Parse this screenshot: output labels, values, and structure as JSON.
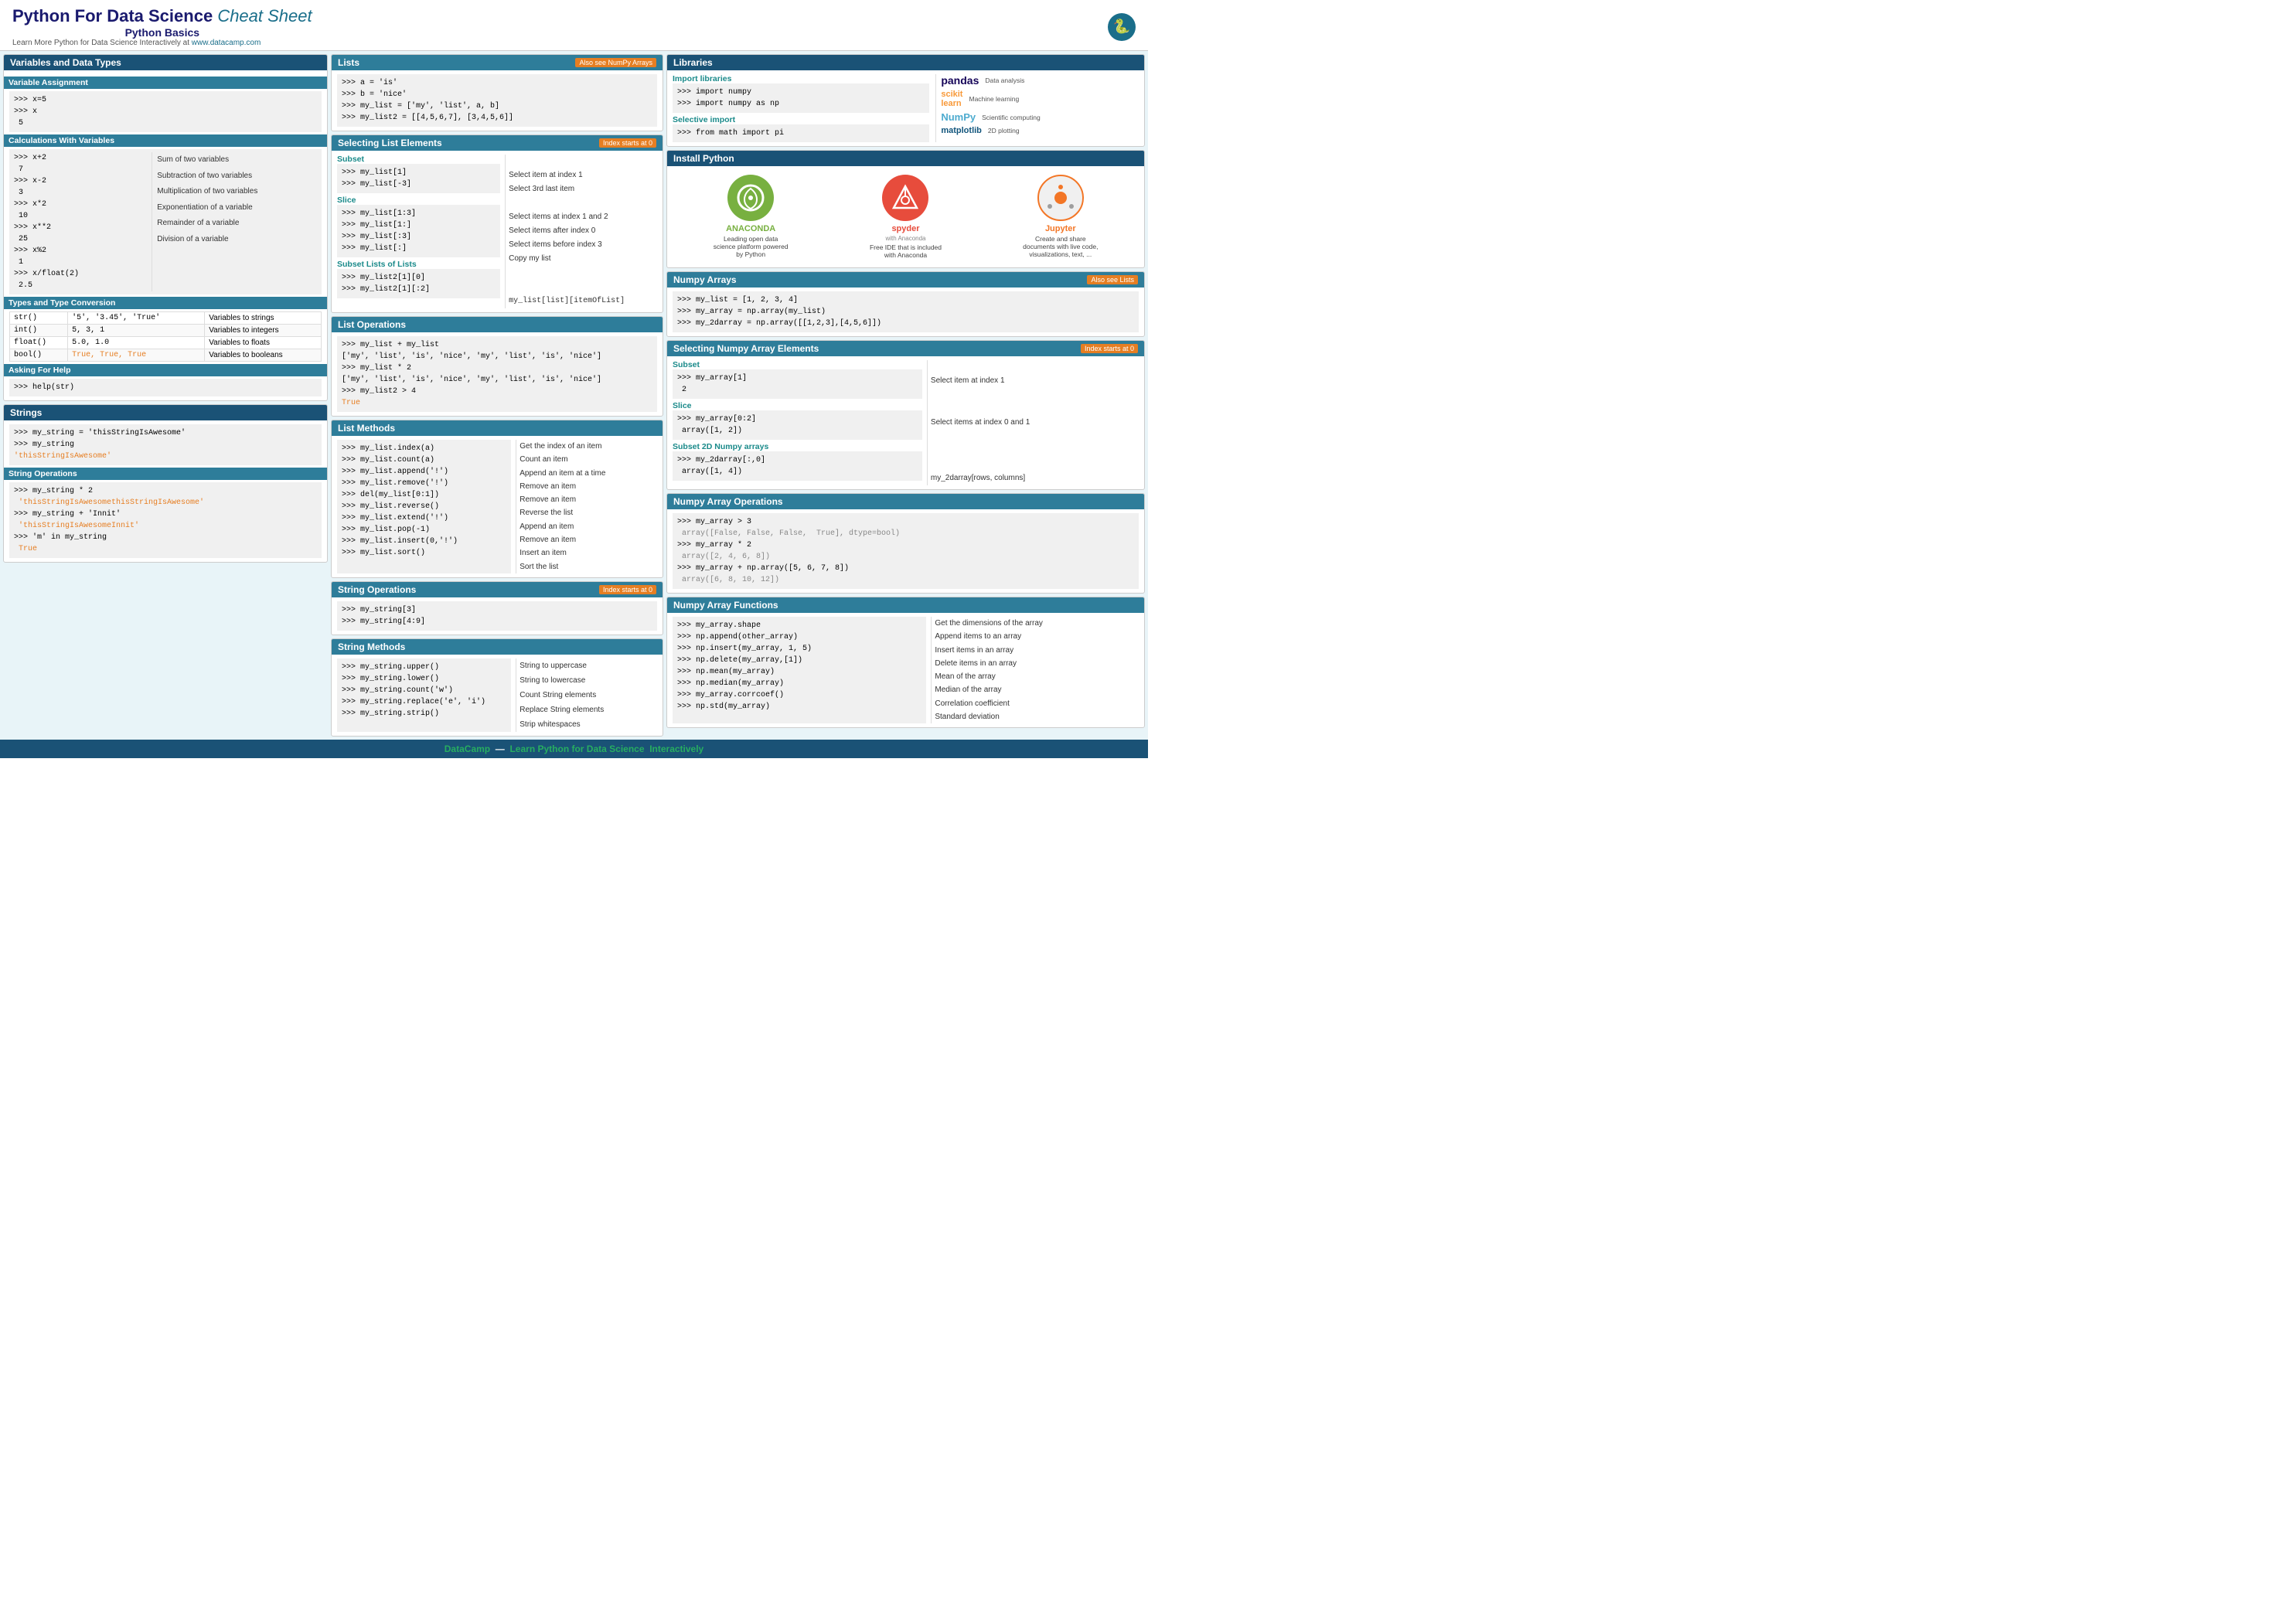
{
  "header": {
    "title_part1": "Python For Data Science",
    "title_italic": "Cheat Sheet",
    "subtitle": "Python Basics",
    "learn_text": "Learn More Python for Data Science Interactively at",
    "url": "www.datacamp.com"
  },
  "variables": {
    "section_title": "Variables and Data Types",
    "assignment_title": "Variable Assignment",
    "assignment_code": ">>> x=5\n>>> x\n 5",
    "calc_title": "Calculations With Variables",
    "calc_rows": [
      {
        "code": ">>> x+2\n 7",
        "desc": "Sum of two variables"
      },
      {
        "code": ">>> x-2\n 3",
        "desc": "Subtraction of two variables"
      },
      {
        "code": ">>> x*2\n 10",
        "desc": "Multiplication of two variables"
      },
      {
        "code": ">>> x**2\n 25",
        "desc": "Exponentiation of a variable"
      },
      {
        "code": ">>> x%2\n 1",
        "desc": "Remainder of a variable"
      },
      {
        "code": ">>> x/float(2)\n 2.5",
        "desc": "Division of a variable"
      }
    ],
    "types_title": "Types and Type Conversion",
    "types_rows": [
      {
        "func": "str()",
        "example": "'5', '3.45', 'True'",
        "desc": "Variables to strings"
      },
      {
        "func": "int()",
        "example": "5, 3, 1",
        "desc": "Variables to integers"
      },
      {
        "func": "float()",
        "example": "5.0, 1.0",
        "desc": "Variables to floats"
      },
      {
        "func": "bool()",
        "example": "True, True, True",
        "desc": "Variables to booleans"
      }
    ],
    "help_title": "Asking For Help",
    "help_code": ">>> help(str)"
  },
  "strings": {
    "section_title": "Strings",
    "code": ">>> my_string = 'thisStringIsAwesome'\n>>> my_string\n'thisStringIsAwesome'",
    "ops_title": "String Operations",
    "ops_code": ">>> my_string * 2\n 'thisStringIsAwesomethisStringIsAwesome'\n>>> my_string + 'Innit'\n 'thisStringIsAwesomeInnit'\n>>> 'm' in my_string\n True"
  },
  "lists": {
    "section_title": "Lists",
    "also_see": "Also see NumPy Arrays",
    "code": ">>> a = 'is'\n>>> b = 'nice'\n>>> my_list = ['my', 'list', a, b]\n>>> my_list2 = [[4,5,6,7], [3,4,5,6]]",
    "selecting_title": "Selecting List Elements",
    "index_badge": "Index starts at 0",
    "subset_title": "Subset",
    "subset_items": [
      {
        "code": ">>> my_list[1]",
        "desc": "Select item at index 1"
      },
      {
        "code": ">>> my_list[-3]",
        "desc": "Select 3rd last item"
      }
    ],
    "slice_title": "Slice",
    "slice_items": [
      {
        "code": ">>> my_list[1:3]",
        "desc": "Select items at index 1 and 2"
      },
      {
        "code": ">>> my_list[1:]",
        "desc": "Select items after index 0"
      },
      {
        "code": ">>> my_list[:3]",
        "desc": "Select items before index 3"
      },
      {
        "code": ">>> my_list[:]",
        "desc": "Copy my list"
      }
    ],
    "subset_lists_title": "Subset Lists of Lists",
    "subset_lists_items": [
      {
        "code": ">>> my_list2[1][0]",
        "desc": ""
      },
      {
        "code": ">>> my_list2[1][:2]",
        "desc": "my_list[list][itemOfList]"
      }
    ],
    "ops_title": "List Operations",
    "ops_code": ">>> my_list + my_list\n['my', 'list', 'is', 'nice', 'my', 'list', 'is', 'nice']\n>>> my_list * 2\n['my', 'list', 'is', 'nice', 'my', 'list', 'is', 'nice']\n>>> my_list2 > 4\nTrue",
    "methods_title": "List Methods",
    "methods": [
      {
        "code": ">>> my_list.index(a)",
        "desc": "Get the index of an item"
      },
      {
        "code": ">>> my_list.count(a)",
        "desc": "Count an item"
      },
      {
        "code": ">>> my_list.append('!')",
        "desc": "Append an item at a time"
      },
      {
        "code": ">>> my_list.remove('!')",
        "desc": "Remove an item"
      },
      {
        "code": ">>> del(my_list[0:1])",
        "desc": "Remove an item"
      },
      {
        "code": ">>> my_list.reverse()",
        "desc": "Reverse the list"
      },
      {
        "code": ">>> my_list.extend('!')",
        "desc": "Append an item"
      },
      {
        "code": ">>> my_list.pop(-1)",
        "desc": "Remove an item"
      },
      {
        "code": ">>> my_list.insert(0,'!')",
        "desc": "Insert an item"
      },
      {
        "code": ">>> my_list.sort()",
        "desc": "Sort the list"
      }
    ]
  },
  "string_ops_mid": {
    "section_title": "String Operations",
    "index_badge": "Index starts at 0",
    "code": ">>> my_string[3]\n>>> my_string[4:9]",
    "methods_title": "String Methods",
    "methods": [
      {
        "code": ">>> my_string.upper()",
        "desc": "String to uppercase"
      },
      {
        "code": ">>> my_string.lower()",
        "desc": "String to lowercase"
      },
      {
        "code": ">>> my_string.count('w')",
        "desc": "Count String elements"
      },
      {
        "code": ">>> my_string.replace('e', 'i')",
        "desc": "Replace String elements"
      },
      {
        "code": ">>> my_string.strip()",
        "desc": "Strip whitespaces"
      }
    ]
  },
  "libraries": {
    "section_title": "Libraries",
    "import_title": "Import libraries",
    "import_code": ">>> import numpy\n>>> import numpy as np",
    "selective_title": "Selective import",
    "selective_code": ">>> from math import pi",
    "logos": [
      {
        "name": "pandas",
        "desc": "Data analysis"
      },
      {
        "name": "scikit-learn",
        "desc": "Machine learning"
      },
      {
        "name": "NumPy",
        "desc": "Scientific computing"
      },
      {
        "name": "matplotlib",
        "desc": "2D plotting"
      }
    ]
  },
  "install": {
    "section_title": "Install Python",
    "items": [
      {
        "name": "ANACONDA",
        "desc": "Leading open data science platform powered by Python"
      },
      {
        "name": "spyder",
        "subtitle": "with Anaconda",
        "desc": "Free IDE that is included with Anaconda"
      },
      {
        "name": "Jupyter",
        "desc": "Create and share documents with live code, visualizations, text, ..."
      }
    ]
  },
  "numpy": {
    "section_title": "Numpy Arrays",
    "also_see": "Also see Lists",
    "code": ">>> my_list = [1, 2, 3, 4]\n>>> my_array = np.array(my_list)\n>>> my_2darray = np.array([[1,2,3],[4,5,6]])",
    "selecting_title": "Selecting Numpy Array Elements",
    "index_badge": "Index starts at 0",
    "subset_title": "Subset",
    "subset_items": [
      {
        "code": ">>> my_array[1]\n 2",
        "desc": "Select item at index 1"
      }
    ],
    "slice_title": "Slice",
    "slice_items": [
      {
        "code": ">>> my_array[0:2]\n array([1, 2])",
        "desc": "Select items at index 0 and 1"
      }
    ],
    "subset2d_title": "Subset 2D Numpy arrays",
    "subset2d_items": [
      {
        "code": ">>> my_2darray[:,0]\n array([1, 4])",
        "desc": "my_2darray[rows, columns]"
      }
    ],
    "ops_title": "Numpy Array Operations",
    "ops_code": ">>> my_array > 3\n array([False, False, False,  True], dtype=bool)\n>>> my_array * 2\n array([2, 4, 6, 8])\n>>> my_array + np.array([5, 6, 7, 8])\n array([6, 8, 10, 12])",
    "functions_title": "Numpy Array Functions",
    "functions": [
      {
        "code": ">>> my_array.shape",
        "desc": "Get the dimensions of the array"
      },
      {
        "code": ">>> np.append(other_array)",
        "desc": "Append items to an array"
      },
      {
        "code": ">>> np.insert(my_array, 1, 5)",
        "desc": "Insert items in an array"
      },
      {
        "code": ">>> np.delete(my_array,[1])",
        "desc": "Delete items in an array"
      },
      {
        "code": ">>> np.mean(my_array)",
        "desc": "Mean of the array"
      },
      {
        "code": ">>> np.median(my_array)",
        "desc": "Median of the array"
      },
      {
        "code": ">>> my_array.corrcoef()",
        "desc": "Correlation coefficient"
      },
      {
        "code": ">>> np.std(my_array)",
        "desc": "Standard deviation"
      }
    ]
  },
  "footer": {
    "brand": "DataCamp",
    "tagline": "Learn Python for Data Science",
    "tagline_colored": "Interactively"
  }
}
